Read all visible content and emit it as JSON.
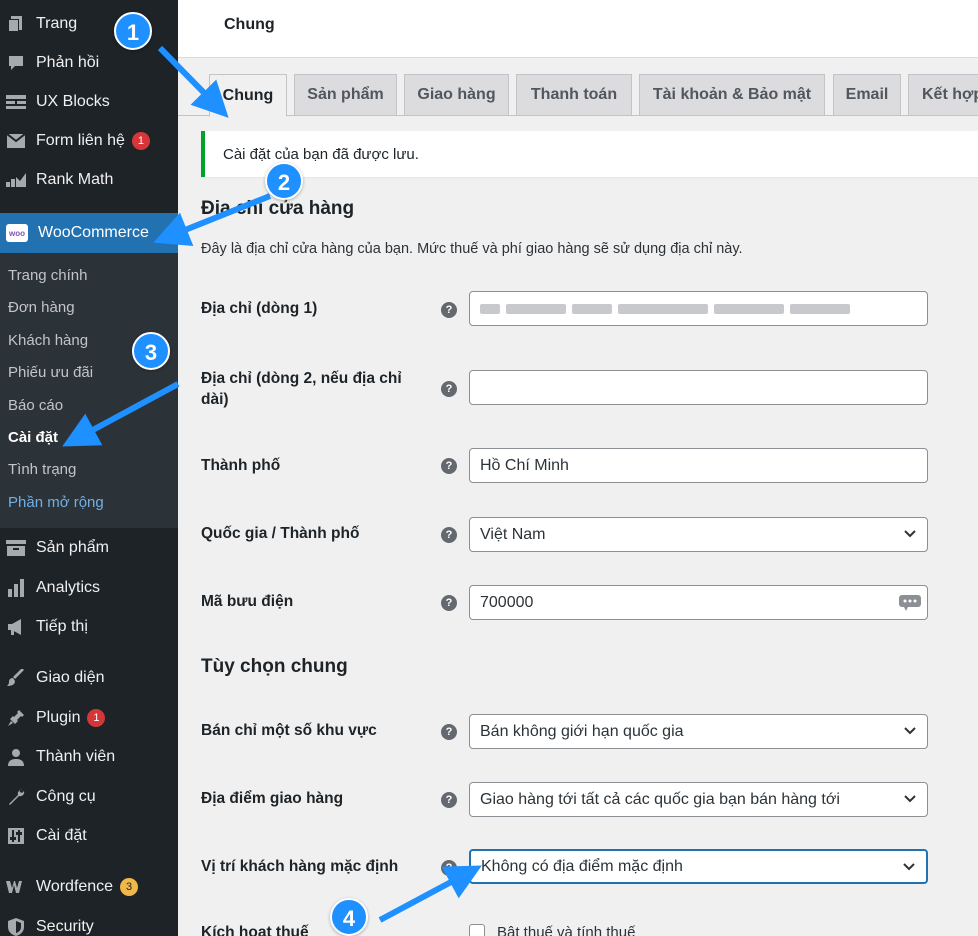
{
  "sidebar": {
    "items": [
      {
        "label": "Trang",
        "icon": "pages-icon"
      },
      {
        "label": "Phản hồi",
        "icon": "comments-icon"
      },
      {
        "label": "UX Blocks",
        "icon": "blocks-icon"
      },
      {
        "label": "Form liên hệ",
        "icon": "mail-icon",
        "badge": "1"
      },
      {
        "label": "Rank Math",
        "icon": "chart-icon"
      },
      {
        "label": "WooCommerce",
        "icon": "woo-icon",
        "logo_text": "woo"
      },
      {
        "label": "Sản phẩm",
        "icon": "archive-icon"
      },
      {
        "label": "Analytics",
        "icon": "bar-chart-icon"
      },
      {
        "label": "Tiếp thị",
        "icon": "megaphone-icon"
      },
      {
        "label": "Giao diện",
        "icon": "brush-icon"
      },
      {
        "label": "Plugin",
        "icon": "plugin-icon",
        "badge": "1"
      },
      {
        "label": "Thành viên",
        "icon": "user-icon"
      },
      {
        "label": "Công cụ",
        "icon": "wrench-icon"
      },
      {
        "label": "Cài đặt",
        "icon": "settings-icon"
      },
      {
        "label": "Wordfence",
        "icon": "wordfence-icon",
        "badge": "3"
      },
      {
        "label": "Security",
        "icon": "shield-icon"
      }
    ],
    "submenu": [
      "Trang chính",
      "Đơn hàng",
      "Khách hàng",
      "Phiếu ưu đãi",
      "Báo cáo",
      "Cài đặt",
      "Tình trạng",
      "Phần mở rộng"
    ]
  },
  "header": {
    "title": "Chung"
  },
  "tabs": [
    "Chung",
    "Sản phẩm",
    "Giao hàng",
    "Thanh toán",
    "Tài khoản & Bảo mật",
    "Email",
    "Kết hợp"
  ],
  "notice": "Cài đặt của bạn đã được lưu.",
  "store_section": {
    "title": "Địa chỉ cửa hàng",
    "description": "Đây là địa chỉ cửa hàng của bạn. Mức thuế và phí giao hàng sẽ sử dụng địa chỉ này."
  },
  "fields": {
    "address1": {
      "label": "Địa chỉ (dòng 1)",
      "value": ""
    },
    "address2": {
      "label": "Địa chỉ (dòng 2, nếu địa chỉ dài)",
      "value": ""
    },
    "city": {
      "label": "Thành phố",
      "value": "Hồ Chí Minh"
    },
    "country": {
      "label": "Quốc gia / Thành phố",
      "value": "Việt Nam"
    },
    "postcode": {
      "label": "Mã bưu điện",
      "value": "700000"
    }
  },
  "general_section": {
    "title": "Tùy chọn chung"
  },
  "general_fields": {
    "selling": {
      "label": "Bán chỉ một số khu vực",
      "value": "Bán không giới hạn quốc gia"
    },
    "shipping": {
      "label": "Địa điểm giao hàng",
      "value": "Giao hàng tới tất cả các quốc gia bạn bán hàng tới"
    },
    "customer_location": {
      "label": "Vị trí khách hàng mặc định",
      "value": "Không có địa điểm mặc định"
    },
    "taxes": {
      "label": "Kích hoạt thuế",
      "checkbox_label": "Bật thuế và tính thuế"
    }
  },
  "help_icon_glyph": "?",
  "annotations": [
    "1",
    "2",
    "3",
    "4"
  ],
  "colors": {
    "sidebar_bg": "#1d2327",
    "active_blue": "#2271b1",
    "notice_green": "#00a32a",
    "annotation_blue": "#1e90ff",
    "badge_red": "#d63638",
    "badge_orange": "#f0b849"
  }
}
